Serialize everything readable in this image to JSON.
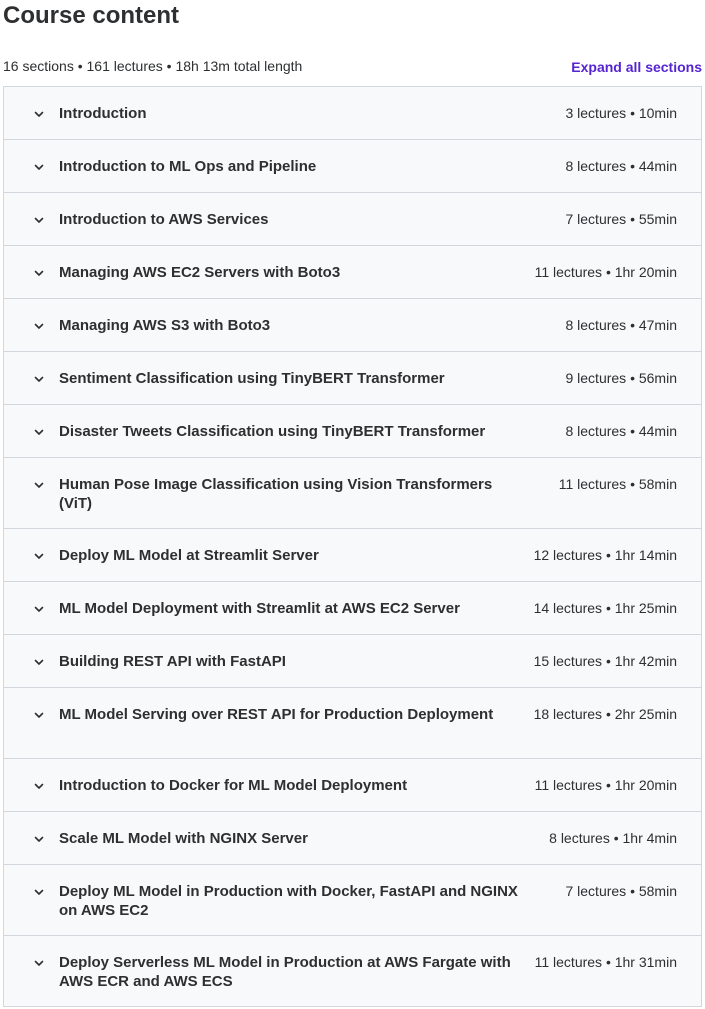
{
  "header": {
    "title": "Course content",
    "summary": "16 sections • 161 lectures • 18h 13m total length",
    "expand_all_label": "Expand all sections"
  },
  "icons": {
    "section_toggle": "chevron-down-icon"
  },
  "colors": {
    "accent": "#5624d0",
    "text": "#2d2f31",
    "section_bg": "#f7f9fa",
    "border": "#d1d7dc"
  },
  "sections": [
    {
      "title": "Introduction",
      "meta": "3 lectures • 10min"
    },
    {
      "title": "Introduction to ML Ops and Pipeline",
      "meta": "8 lectures • 44min"
    },
    {
      "title": "Introduction to AWS Services",
      "meta": "7 lectures • 55min"
    },
    {
      "title": "Managing AWS EC2 Servers with Boto3",
      "meta": "11 lectures • 1hr 20min"
    },
    {
      "title": "Managing AWS S3 with Boto3",
      "meta": "8 lectures • 47min"
    },
    {
      "title": "Sentiment Classification using TinyBERT Transformer",
      "meta": "9 lectures • 56min"
    },
    {
      "title": "Disaster Tweets Classification using TinyBERT Transformer",
      "meta": "8 lectures • 44min"
    },
    {
      "title": "Human Pose Image Classification using Vision Transformers (ViT)",
      "meta": "11 lectures • 58min"
    },
    {
      "title": "Deploy ML Model at Streamlit Server",
      "meta": "12 lectures • 1hr 14min"
    },
    {
      "title": "ML Model Deployment with Streamlit at AWS EC2 Server",
      "meta": "14 lectures • 1hr 25min"
    },
    {
      "title": "Building REST API with FastAPI",
      "meta": "15 lectures • 1hr 42min"
    },
    {
      "title": "ML Model Serving over REST API for Production Deployment",
      "meta": "18 lectures • 2hr 25min"
    },
    {
      "title": "Introduction to Docker for ML Model Deployment",
      "meta": "11 lectures • 1hr 20min"
    },
    {
      "title": "Scale ML Model with NGINX Server",
      "meta": "8 lectures • 1hr 4min"
    },
    {
      "title": "Deploy ML Model in Production with Docker, FastAPI and NGINX on AWS EC2",
      "meta": "7 lectures • 58min"
    },
    {
      "title": "Deploy Serverless ML Model in Production at AWS Fargate with AWS ECR and AWS ECS",
      "meta": "11 lectures • 1hr 31min"
    }
  ]
}
